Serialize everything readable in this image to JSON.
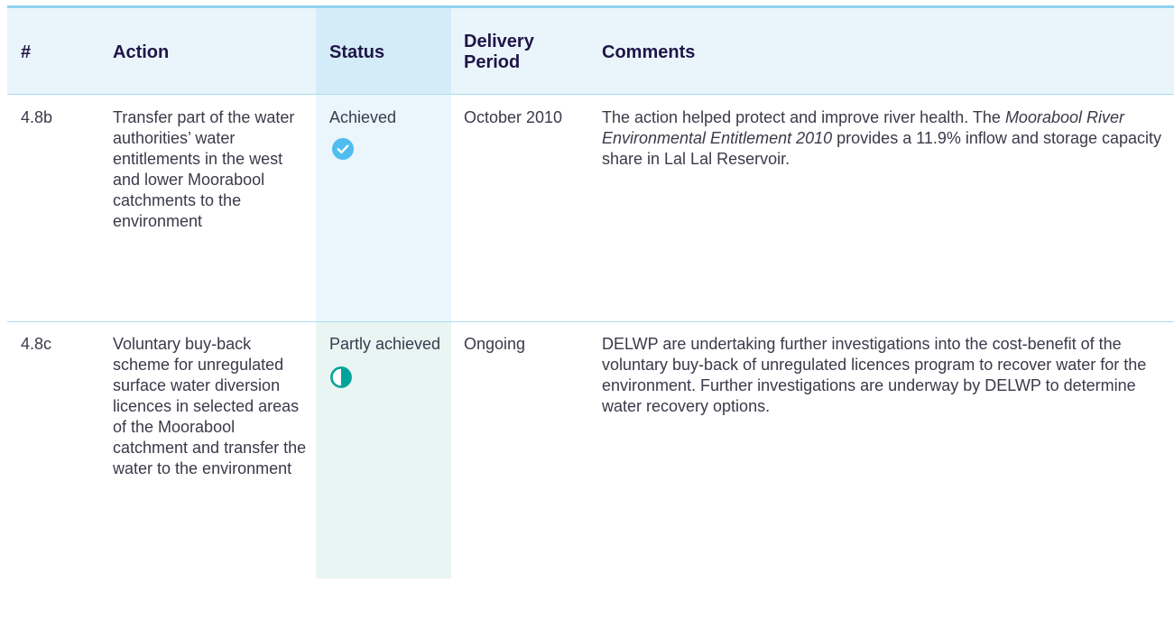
{
  "table": {
    "headers": {
      "num": "#",
      "action": "Action",
      "status": "Status",
      "period_line1": "Delivery",
      "period_line2": "Period",
      "comments": "Comments"
    },
    "rows": [
      {
        "num": "4.8b",
        "action": "Transfer part of the water authorities’ water entitlements in the west and lower Moorabool catchments to the environment",
        "status": "Achieved",
        "status_icon": "check-circle-icon",
        "period": "October 2010",
        "comments_pre": "The action helped protect and improve river health. The ",
        "comments_em": "Moorabool River Environmental Entitlement 2010",
        "comments_post": " provides a 11.9% inflow and storage capacity share in Lal Lal Reservoir."
      },
      {
        "num": "4.8c",
        "action": "Voluntary buy-back scheme for unregulated surface water diversion licences in selected areas of the Moorabool catchment and transfer the water to the environment",
        "status": "Partly achieved",
        "status_icon": "half-circle-icon",
        "period": "Ongoing",
        "comments": "DELWP are undertaking further investigations into the cost-benefit of the voluntary buy-back of unregulated licences program to recover water for the environment. Further investigations are underway by DELWP to determine water recovery options."
      }
    ]
  },
  "colors": {
    "header_text": "#201547",
    "rule": "#8fd3f0",
    "achieved_icon": "#4fbdee",
    "partly_icon": "#00a39a"
  }
}
